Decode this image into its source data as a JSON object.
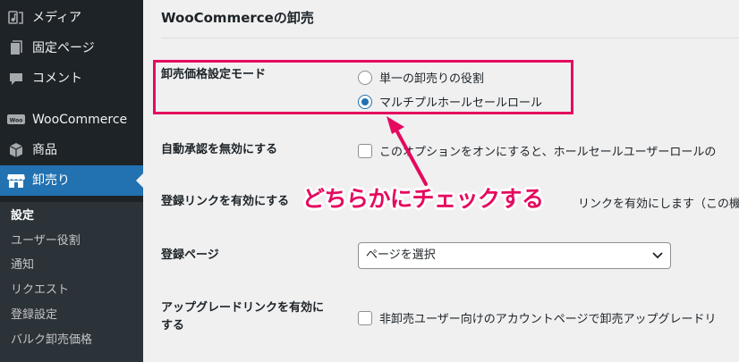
{
  "sidebar": {
    "items": [
      {
        "label": "メディア",
        "icon": "media-icon"
      },
      {
        "label": "固定ページ",
        "icon": "page-icon"
      },
      {
        "label": "コメント",
        "icon": "comment-icon"
      },
      {
        "label": "WooCommerce",
        "icon": "woocommerce-icon"
      },
      {
        "label": "商品",
        "icon": "product-box-icon"
      },
      {
        "label": "卸売り",
        "icon": "store-icon"
      }
    ],
    "submenu": [
      "設定",
      "ユーザー役割",
      "通知",
      "リクエスト",
      "登録設定",
      "バルク卸売価格"
    ]
  },
  "main": {
    "heading": "WooCommerceの卸売",
    "mode": {
      "label": "卸売価格設定モード",
      "options": [
        "単一の卸売りの役割",
        "マルチプルホールセールロール"
      ],
      "selected": "マルチプルホールセールロール"
    },
    "auto_approval": {
      "label": "自動承認を無効にする",
      "text": "このオプションをオンにすると、ホールセールユーザーロールの"
    },
    "registration_link": {
      "label": "登録リンクを有効にする",
      "text": "リンクを有効にします（この機能を"
    },
    "registration_page": {
      "label": "登録ページ",
      "placeholder": "ページを選択"
    },
    "upgrade_link": {
      "label_line1": "アップグレードリンクを有効に",
      "label_line2": "する",
      "text": "非卸売ユーザー向けのアカウントページで卸売アップグレードリ"
    }
  },
  "annotation": {
    "text": "どちらかにチェックする",
    "color": "#e5095f"
  },
  "colors": {
    "sidebar_bg": "#1d2327",
    "accent": "#2271b1"
  }
}
